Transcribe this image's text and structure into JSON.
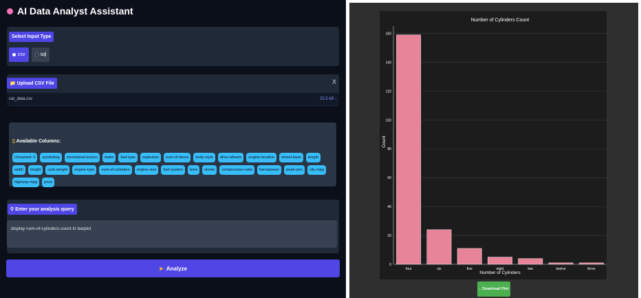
{
  "app": {
    "title": "AI Data Analyst Assistant"
  },
  "input_type": {
    "label": "Select Input Type",
    "options": [
      "csv",
      "sql"
    ],
    "selected": "csv"
  },
  "upload": {
    "label": "Upload CSV File",
    "close_label": "X",
    "file_name": "car_data.csv",
    "file_size": "25.5 kB ↓"
  },
  "columns": {
    "label": "Available Columns:",
    "items": [
      "Unnamed: 0",
      "symboling",
      "normalized-losses",
      "make",
      "fuel-type",
      "aspiration",
      "num-of-doors",
      "body-style",
      "drive-wheels",
      "engine-location",
      "wheel-base",
      "length",
      "width",
      "height",
      "curb-weight",
      "engine-type",
      "num-of-cylinders",
      "engine-size",
      "fuel-system",
      "bore",
      "stroke",
      "compression-ratio",
      "horsepower",
      "peak-rpm",
      "city-mpg",
      "highway-mpg",
      "price"
    ]
  },
  "query": {
    "label": "Enter your analysis query",
    "value": "display num-of-cylinders count in barplot"
  },
  "analyze": {
    "label": "Analyze"
  },
  "download": {
    "label": "Download Plot"
  },
  "colors": {
    "accent": "#4f46e5",
    "bar": "#e8849a",
    "tag": "#38bdf8",
    "download": "#4caf50"
  },
  "chart_data": {
    "type": "bar",
    "title": "Number of Cylinders Count",
    "xlabel": "Number of Cylinders",
    "ylabel": "Count",
    "categories": [
      "four",
      "six",
      "five",
      "eight",
      "two",
      "twelve",
      "three"
    ],
    "values": [
      159,
      24,
      11,
      5,
      4,
      1,
      1
    ],
    "ylim": [
      0,
      165
    ],
    "yticks": [
      0,
      20,
      40,
      60,
      80,
      100,
      120,
      140,
      160
    ],
    "grid": true
  }
}
